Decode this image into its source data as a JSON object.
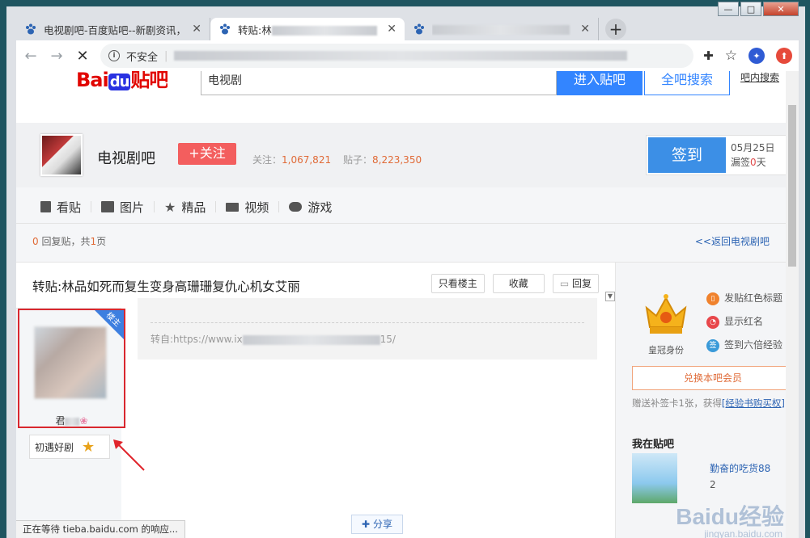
{
  "browser": {
    "tabs": [
      {
        "title": "电视剧吧-百度贴吧--新剧资讯，",
        "active": false
      },
      {
        "title": "转贴:林",
        "active": true
      },
      {
        "title": "",
        "active": false
      }
    ],
    "new_tab": "+",
    "security_label": "不安全",
    "url": ""
  },
  "search": {
    "logo_bai": "Bai",
    "logo_du": "du",
    "logo_tieba": "贴吧",
    "query": "电视剧",
    "enter_button": "进入贴吧",
    "all_button": "全吧搜索",
    "inner_link": "吧内搜索"
  },
  "forum": {
    "name": "电视剧吧",
    "follow_button": "+关注",
    "followers_label": "关注：",
    "followers": "1,067,821",
    "posts_label": "贴子：",
    "posts": "8,223,350",
    "sign_button": "签到",
    "sign_date": "05月25日",
    "missed_label": "漏签",
    "missed_count": "0",
    "missed_unit": "天",
    "nav": [
      "看贴",
      "图片",
      "精品",
      "视频",
      "游戏"
    ],
    "reply_count": "0",
    "reply_text": "回复贴，共",
    "page_count": "1",
    "page_unit": "页",
    "back_link": "<<返回电视剧吧"
  },
  "thread": {
    "title": "转贴:林品如死而复生变身高珊珊复仇心机女艾丽",
    "only_owner": "只看楼主",
    "favorite": "收藏",
    "reply": "回复",
    "owner_badge": "楼主",
    "author": "君",
    "level_name": "初遇好剧",
    "level": "1",
    "source_prefix": "转自:https://www.ix",
    "source_suffix": "15/",
    "share": "分享"
  },
  "sidebar": {
    "crown_label": "皇冠身份",
    "perks": [
      "发贴红色标题",
      "显示红名",
      "签到六倍经验"
    ],
    "vip_button": "兑换本吧会员",
    "vip_note_prefix": "赠送补签卡1张，获得",
    "vip_note_link": "[经验书购买权]",
    "my_tieba": "我在贴吧",
    "my_name": "勤奋的吃货88",
    "my_level": "2"
  },
  "status_text": "正在等待 tieba.baidu.com 的响应...",
  "watermark": "Baidu经验",
  "watermark_sub": "jingyan.baidu.com",
  "colors": {
    "accent": "#3385ff",
    "follow": "#f35e5e",
    "highlight": "#d9272e",
    "sign": "#3c8fe6"
  }
}
